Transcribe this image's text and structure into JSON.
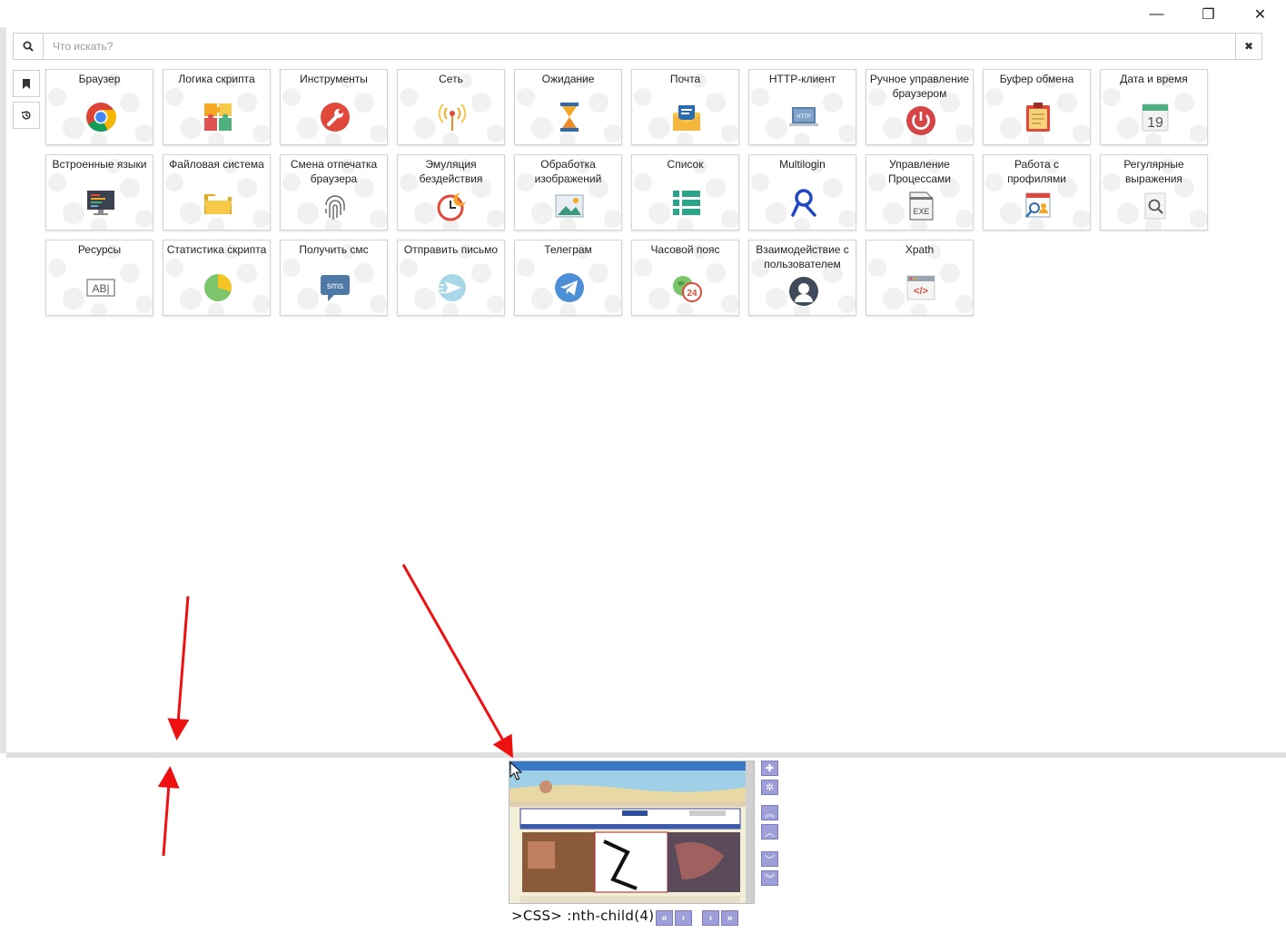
{
  "window": {
    "minimize": "—",
    "maximize": "❐",
    "close": "✕"
  },
  "search": {
    "placeholder": "Что искать?",
    "clear": "✖"
  },
  "tiles": [
    {
      "label": "Браузер",
      "icon": "chrome-icon"
    },
    {
      "label": "Логика скрипта",
      "icon": "puzzle-icon"
    },
    {
      "label": "Инструменты",
      "icon": "wrench-icon"
    },
    {
      "label": "Сеть",
      "icon": "antenna-icon"
    },
    {
      "label": "Ожидание",
      "icon": "hourglass-icon"
    },
    {
      "label": "Почта",
      "icon": "mail-icon"
    },
    {
      "label": "HTTP-клиент",
      "icon": "http-laptop-icon"
    },
    {
      "label": "Ручное управление браузером",
      "icon": "power-icon"
    },
    {
      "label": "Буфер обмена",
      "icon": "clipboard-icon"
    },
    {
      "label": "Дата и время",
      "icon": "calendar-icon",
      "day": "19"
    },
    {
      "label": "Встроенные языки",
      "icon": "monitor-code-icon"
    },
    {
      "label": "Файловая система",
      "icon": "folder-icon"
    },
    {
      "label": "Смена отпечатка браузера",
      "icon": "fingerprint-icon"
    },
    {
      "label": "Эмуляция бездействия",
      "icon": "idle-clock-icon"
    },
    {
      "label": "Обработка изображений",
      "icon": "image-icon"
    },
    {
      "label": "Список",
      "icon": "list-icon"
    },
    {
      "label": "Multilogin",
      "icon": "multilogin-icon"
    },
    {
      "label": "Управление Процессами",
      "icon": "exe-file-icon",
      "badge": "EXE"
    },
    {
      "label": "Работа с профилями",
      "icon": "profile-search-icon"
    },
    {
      "label": "Регулярные выражения",
      "icon": "regex-search-icon"
    },
    {
      "label": "Ресурсы",
      "icon": "text-resource-icon",
      "badge": "AB|"
    },
    {
      "label": "Статистика скрипта",
      "icon": "pie-chart-icon"
    },
    {
      "label": "Получить смс",
      "icon": "sms-icon",
      "badge": "sms"
    },
    {
      "label": "Отправить письмо",
      "icon": "send-mail-icon"
    },
    {
      "label": "Телеграм",
      "icon": "telegram-icon"
    },
    {
      "label": "Часовой пояс",
      "icon": "timezone-icon",
      "badge": "24"
    },
    {
      "label": "Взаимодействие с пользователем",
      "icon": "user-icon"
    },
    {
      "label": "Xpath",
      "icon": "xpath-code-icon",
      "badge": "</>"
    }
  ],
  "preview": {
    "selector": ">CSS> :nth-child(4)"
  },
  "colors": {
    "accent": "#9e9ed8",
    "arrow": "#ee1111"
  }
}
